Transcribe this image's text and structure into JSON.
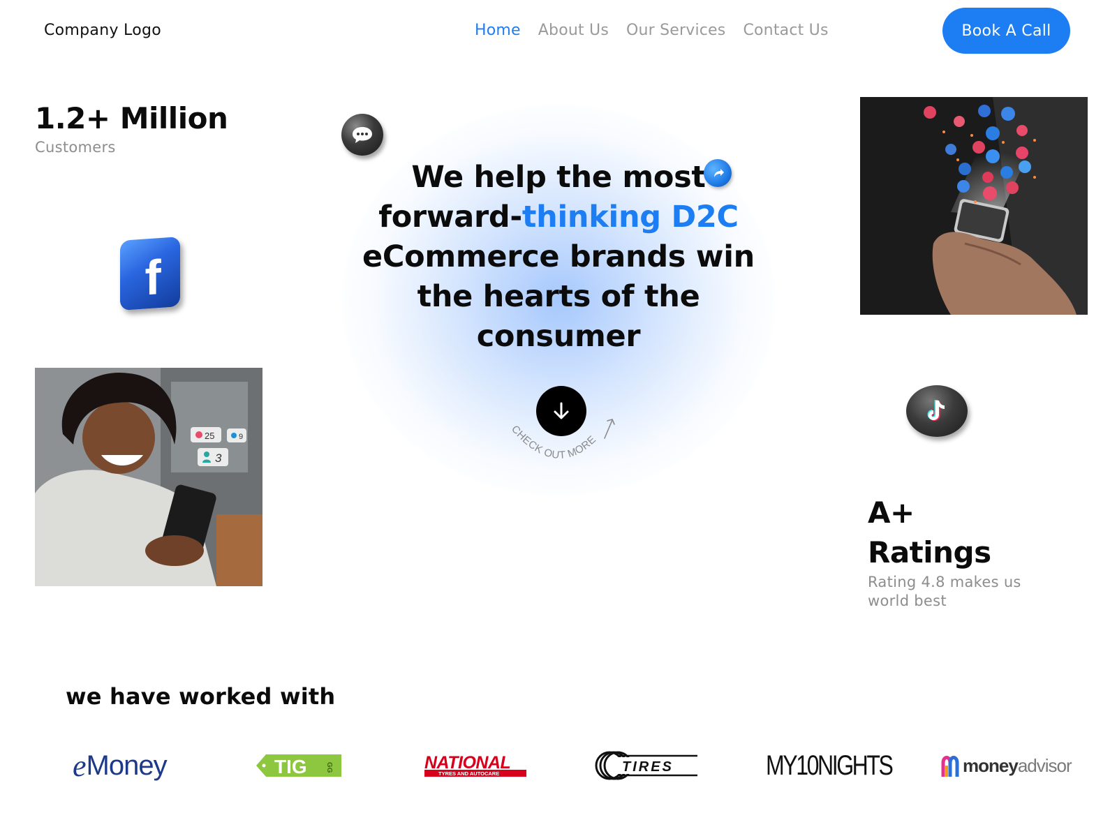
{
  "header": {
    "logo_text": "Company Logo",
    "nav": [
      {
        "label": "Home",
        "active": true
      },
      {
        "label": "About Us",
        "active": false
      },
      {
        "label": "Our Services",
        "active": false
      },
      {
        "label": "Contact Us",
        "active": false
      }
    ],
    "cta_label": "Book A Call"
  },
  "stats": {
    "customers_value": "1.2+ Million",
    "customers_label": "Customers",
    "rating_value_line1": "A+",
    "rating_value_line2": "Ratings",
    "rating_desc_line1": "Rating 4.8 makes us",
    "rating_desc_line2": "world best"
  },
  "hero": {
    "line1": "We help the most",
    "line2_prefix": "forward-",
    "line2_accent": "thinking D2C",
    "line3": "eCommerce brands win",
    "line4": "the hearts of the",
    "line5": "consumer",
    "scroll_label": "CHECK OUT MORE"
  },
  "woman_photo": {
    "like_count": "25",
    "comment_count": "9",
    "follower_count": "3"
  },
  "partners": {
    "title": "we have worked with",
    "emoney_prefix": "e",
    "emoney_rest": "Money",
    "tig": "TIG",
    "tig_sub": "GG",
    "national": "NATIONAL",
    "national_sub": "TYRES AND AUTOCARE",
    "tires": "TIRES",
    "my10nights": "MY10NIGHTS",
    "moneyadvisor_money": "money",
    "moneyadvisor_advisor": "advisor"
  },
  "colors": {
    "accent": "#1d7df2",
    "muted": "#9a9a9a",
    "text": "#0b0b0b"
  }
}
